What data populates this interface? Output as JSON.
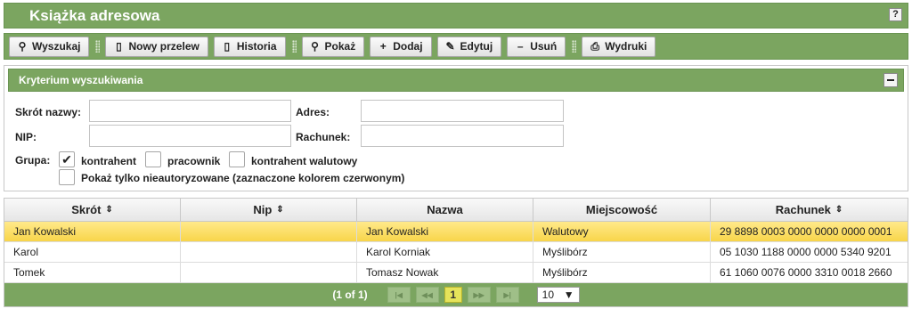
{
  "window": {
    "title": "Książka adresowa",
    "help_label": "?"
  },
  "toolbar": {
    "search_label": "Wyszukaj",
    "new_transfer_label": "Nowy przelew",
    "history_label": "Historia",
    "show_label": "Pokaż",
    "add_label": "Dodaj",
    "edit_label": "Edytuj",
    "delete_label": "Usuń",
    "print_label": "Wydruki"
  },
  "criteria": {
    "title": "Kryterium wyszukiwania",
    "short_name_label": "Skrót nazwy:",
    "short_name_value": "",
    "address_label": "Adres:",
    "address_value": "",
    "nip_label": "NIP:",
    "nip_value": "",
    "account_label": "Rachunek:",
    "account_value": "",
    "group_label": "Grupa:",
    "groups": [
      {
        "label": "kontrahent",
        "checked": true
      },
      {
        "label": "pracownik",
        "checked": false
      },
      {
        "label": "kontrahent walutowy",
        "checked": false
      }
    ],
    "unauthorized_label": "Pokaż tylko nieautoryzowane (zaznaczone kolorem czerwonym)",
    "unauthorized_checked": false
  },
  "table": {
    "columns": [
      "Skrót",
      "Nip",
      "Nazwa",
      "Miejscowość",
      "Rachunek"
    ],
    "rows": [
      [
        "Jan Kowalski",
        "",
        "Jan Kowalski",
        "Walutowy",
        "29 8898 0003 0000 0000 0000 0001"
      ],
      [
        "Karol",
        "",
        "Karol Korniak",
        "Myślibórz",
        "05 1030 1188 0000 0000 5340 9201"
      ],
      [
        "Tomek",
        "",
        "Tomasz Nowak",
        "Myślibórz",
        "61 1060 0076 0000 3310 0018 2660"
      ]
    ],
    "selected_row": 0
  },
  "pager": {
    "info": "(1 of 1)",
    "current_page": "1",
    "rows_per_page": "10"
  }
}
